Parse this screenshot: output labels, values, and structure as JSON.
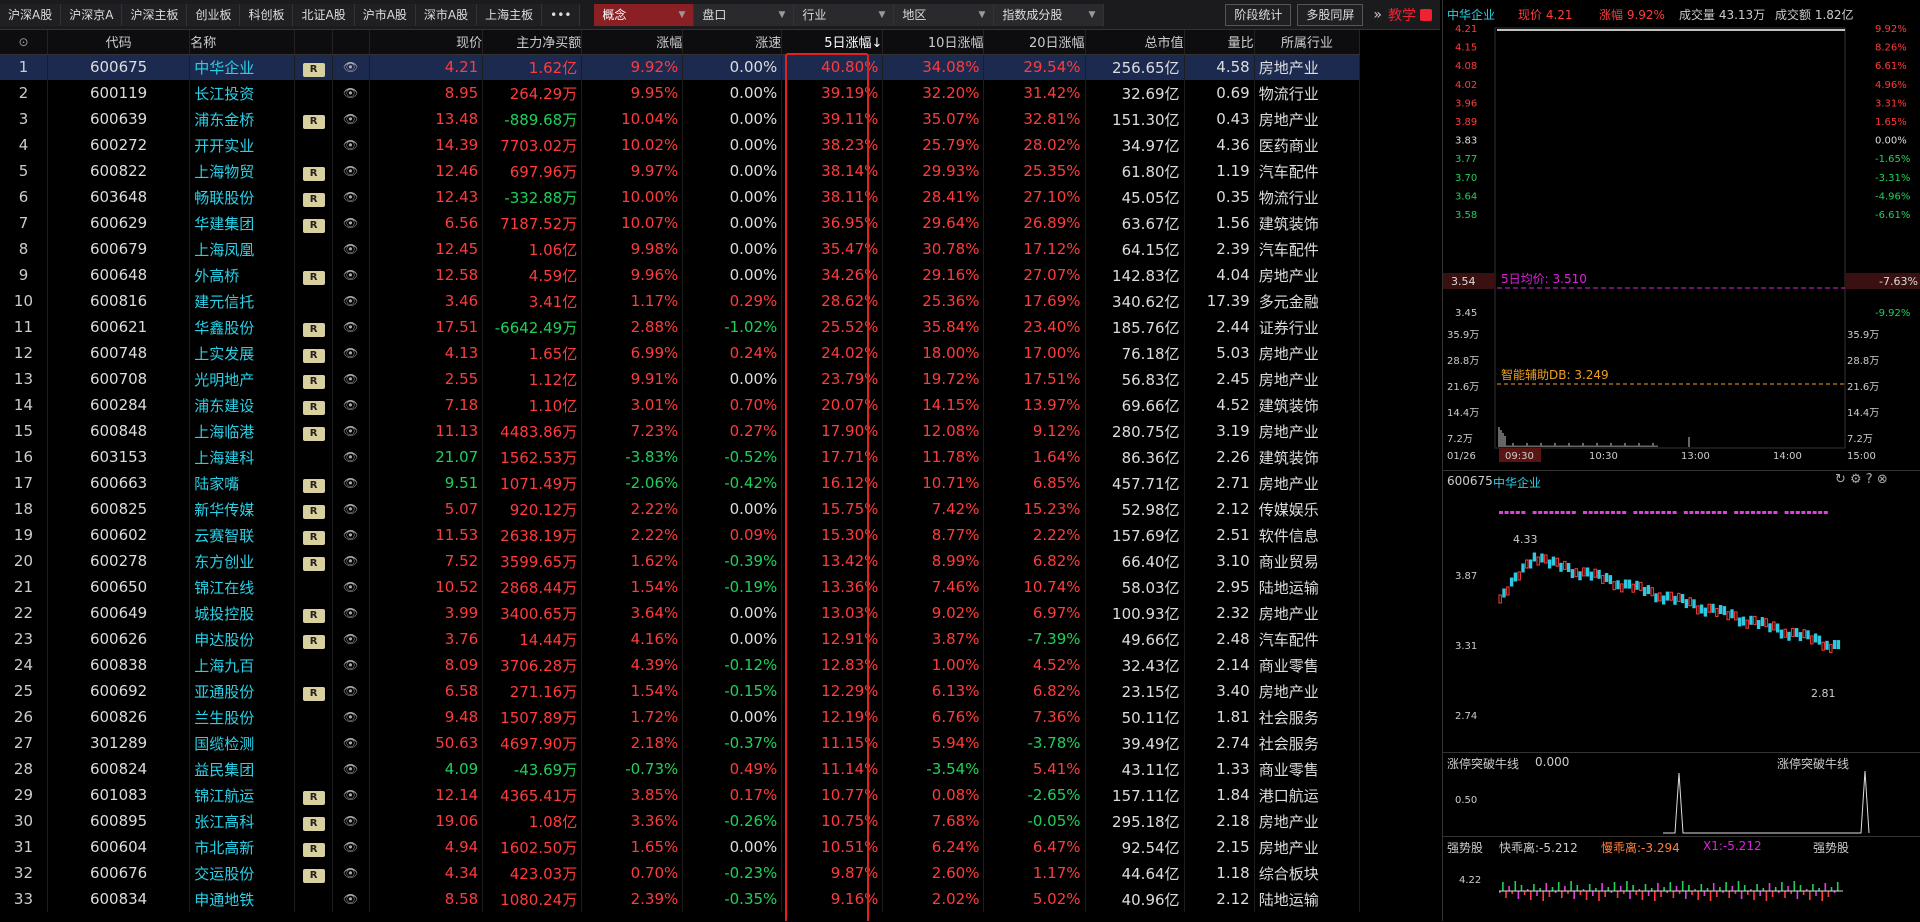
{
  "toolbar": {
    "tabs": [
      "沪深A股",
      "沪深京A",
      "沪深主板",
      "创业板",
      "科创板",
      "北证A股",
      "沪市A股",
      "深市A股",
      "上海主板"
    ],
    "more": "•••",
    "dropdowns": [
      "概念",
      "盘口",
      "行业",
      "地区",
      "指数成分股"
    ],
    "active_dropdown": "概念",
    "buttons": [
      "阶段统计",
      "多股同屏"
    ],
    "teach": "教学"
  },
  "table": {
    "headers": [
      "代码",
      "名称",
      "",
      "",
      "现价",
      "主力净买额",
      "涨幅",
      "涨速",
      "5日涨幅↓",
      "10日涨幅",
      "20日涨幅",
      "总市值",
      "量比",
      "所属行业"
    ],
    "rows": [
      {
        "i": "1",
        "code": "600675",
        "name": "中华企业",
        "r": true,
        "price": "4.21",
        "pc": "red",
        "net": "1.62亿",
        "nc": "red",
        "chg": "9.92%",
        "cc": "red",
        "spd": "0.00%",
        "sc": "white",
        "d5": "40.80%",
        "d5c": "red",
        "d10": "34.08%",
        "d10c": "red",
        "d20": "29.54%",
        "d20c": "red",
        "cap": "256.65亿",
        "vr": "4.58",
        "ind": "房地产业"
      },
      {
        "i": "2",
        "code": "600119",
        "name": "长江投资",
        "r": false,
        "price": "8.95",
        "pc": "red",
        "net": "264.29万",
        "nc": "red",
        "chg": "9.95%",
        "cc": "red",
        "spd": "0.00%",
        "sc": "white",
        "d5": "39.19%",
        "d5c": "red",
        "d10": "32.20%",
        "d10c": "red",
        "d20": "31.42%",
        "d20c": "red",
        "cap": "32.69亿",
        "vr": "0.69",
        "ind": "物流行业"
      },
      {
        "i": "3",
        "code": "600639",
        "name": "浦东金桥",
        "r": true,
        "price": "13.48",
        "pc": "red",
        "net": "-889.68万",
        "nc": "green",
        "chg": "10.04%",
        "cc": "red",
        "spd": "0.00%",
        "sc": "white",
        "d5": "39.11%",
        "d5c": "red",
        "d10": "35.07%",
        "d10c": "red",
        "d20": "32.81%",
        "d20c": "red",
        "cap": "151.30亿",
        "vr": "0.43",
        "ind": "房地产业"
      },
      {
        "i": "4",
        "code": "600272",
        "name": "开开实业",
        "r": false,
        "price": "14.39",
        "pc": "red",
        "net": "7703.02万",
        "nc": "red",
        "chg": "10.02%",
        "cc": "red",
        "spd": "0.00%",
        "sc": "white",
        "d5": "38.23%",
        "d5c": "red",
        "d10": "25.79%",
        "d10c": "red",
        "d20": "28.02%",
        "d20c": "red",
        "cap": "34.97亿",
        "vr": "4.36",
        "ind": "医药商业"
      },
      {
        "i": "5",
        "code": "600822",
        "name": "上海物贸",
        "r": true,
        "price": "12.46",
        "pc": "red",
        "net": "697.96万",
        "nc": "red",
        "chg": "9.97%",
        "cc": "red",
        "spd": "0.00%",
        "sc": "white",
        "d5": "38.14%",
        "d5c": "red",
        "d10": "29.93%",
        "d10c": "red",
        "d20": "25.35%",
        "d20c": "red",
        "cap": "61.80亿",
        "vr": "1.19",
        "ind": "汽车配件"
      },
      {
        "i": "6",
        "code": "603648",
        "name": "畅联股份",
        "r": true,
        "price": "12.43",
        "pc": "red",
        "net": "-332.88万",
        "nc": "green",
        "chg": "10.00%",
        "cc": "red",
        "spd": "0.00%",
        "sc": "white",
        "d5": "38.11%",
        "d5c": "red",
        "d10": "28.41%",
        "d10c": "red",
        "d20": "27.10%",
        "d20c": "red",
        "cap": "45.05亿",
        "vr": "0.35",
        "ind": "物流行业"
      },
      {
        "i": "7",
        "code": "600629",
        "name": "华建集团",
        "r": true,
        "price": "6.56",
        "pc": "red",
        "net": "7187.52万",
        "nc": "red",
        "chg": "10.07%",
        "cc": "red",
        "spd": "0.00%",
        "sc": "white",
        "d5": "36.95%",
        "d5c": "red",
        "d10": "29.64%",
        "d10c": "red",
        "d20": "26.89%",
        "d20c": "red",
        "cap": "63.67亿",
        "vr": "1.56",
        "ind": "建筑装饰"
      },
      {
        "i": "8",
        "code": "600679",
        "name": "上海凤凰",
        "r": false,
        "price": "12.45",
        "pc": "red",
        "net": "1.06亿",
        "nc": "red",
        "chg": "9.98%",
        "cc": "red",
        "spd": "0.00%",
        "sc": "white",
        "d5": "35.47%",
        "d5c": "red",
        "d10": "30.78%",
        "d10c": "red",
        "d20": "17.12%",
        "d20c": "red",
        "cap": "64.15亿",
        "vr": "2.39",
        "ind": "汽车配件"
      },
      {
        "i": "9",
        "code": "600648",
        "name": "外高桥",
        "r": true,
        "price": "12.58",
        "pc": "red",
        "net": "4.59亿",
        "nc": "red",
        "chg": "9.96%",
        "cc": "red",
        "spd": "0.00%",
        "sc": "white",
        "d5": "34.26%",
        "d5c": "red",
        "d10": "29.16%",
        "d10c": "red",
        "d20": "27.07%",
        "d20c": "red",
        "cap": "142.83亿",
        "vr": "4.04",
        "ind": "房地产业"
      },
      {
        "i": "10",
        "code": "600816",
        "name": "建元信托",
        "r": false,
        "price": "3.46",
        "pc": "red",
        "net": "3.41亿",
        "nc": "red",
        "chg": "1.17%",
        "cc": "red",
        "spd": "0.29%",
        "sc": "red",
        "d5": "28.62%",
        "d5c": "red",
        "d10": "25.36%",
        "d10c": "red",
        "d20": "17.69%",
        "d20c": "red",
        "cap": "340.62亿",
        "vr": "17.39",
        "ind": "多元金融"
      },
      {
        "i": "11",
        "code": "600621",
        "name": "华鑫股份",
        "r": true,
        "price": "17.51",
        "pc": "red",
        "net": "-6642.49万",
        "nc": "green",
        "chg": "2.88%",
        "cc": "red",
        "spd": "-1.02%",
        "sc": "green",
        "d5": "25.52%",
        "d5c": "red",
        "d10": "35.84%",
        "d10c": "red",
        "d20": "23.40%",
        "d20c": "red",
        "cap": "185.76亿",
        "vr": "2.44",
        "ind": "证券行业"
      },
      {
        "i": "12",
        "code": "600748",
        "name": "上实发展",
        "r": true,
        "price": "4.13",
        "pc": "red",
        "net": "1.65亿",
        "nc": "red",
        "chg": "6.99%",
        "cc": "red",
        "spd": "0.24%",
        "sc": "red",
        "d5": "24.02%",
        "d5c": "red",
        "d10": "18.00%",
        "d10c": "red",
        "d20": "17.00%",
        "d20c": "red",
        "cap": "76.18亿",
        "vr": "5.03",
        "ind": "房地产业"
      },
      {
        "i": "13",
        "code": "600708",
        "name": "光明地产",
        "r": true,
        "price": "2.55",
        "pc": "red",
        "net": "1.12亿",
        "nc": "red",
        "chg": "9.91%",
        "cc": "red",
        "spd": "0.00%",
        "sc": "white",
        "d5": "23.79%",
        "d5c": "red",
        "d10": "19.72%",
        "d10c": "red",
        "d20": "17.51%",
        "d20c": "red",
        "cap": "56.83亿",
        "vr": "2.45",
        "ind": "房地产业"
      },
      {
        "i": "14",
        "code": "600284",
        "name": "浦东建设",
        "r": true,
        "price": "7.18",
        "pc": "red",
        "net": "1.10亿",
        "nc": "red",
        "chg": "3.01%",
        "cc": "red",
        "spd": "0.70%",
        "sc": "red",
        "d5": "20.07%",
        "d5c": "red",
        "d10": "14.15%",
        "d10c": "red",
        "d20": "13.97%",
        "d20c": "red",
        "cap": "69.66亿",
        "vr": "4.52",
        "ind": "建筑装饰"
      },
      {
        "i": "15",
        "code": "600848",
        "name": "上海临港",
        "r": true,
        "price": "11.13",
        "pc": "red",
        "net": "4483.86万",
        "nc": "red",
        "chg": "7.23%",
        "cc": "red",
        "spd": "0.27%",
        "sc": "red",
        "d5": "17.90%",
        "d5c": "red",
        "d10": "12.08%",
        "d10c": "red",
        "d20": "9.12%",
        "d20c": "red",
        "cap": "280.75亿",
        "vr": "3.19",
        "ind": "房地产业"
      },
      {
        "i": "16",
        "code": "603153",
        "name": "上海建科",
        "r": false,
        "price": "21.07",
        "pc": "green",
        "net": "1562.53万",
        "nc": "red",
        "chg": "-3.83%",
        "cc": "green",
        "spd": "-0.52%",
        "sc": "green",
        "d5": "17.71%",
        "d5c": "red",
        "d10": "11.78%",
        "d10c": "red",
        "d20": "1.64%",
        "d20c": "red",
        "cap": "86.36亿",
        "vr": "2.26",
        "ind": "建筑装饰"
      },
      {
        "i": "17",
        "code": "600663",
        "name": "陆家嘴",
        "r": true,
        "price": "9.51",
        "pc": "green",
        "net": "1071.49万",
        "nc": "red",
        "chg": "-2.06%",
        "cc": "green",
        "spd": "-0.42%",
        "sc": "green",
        "d5": "16.12%",
        "d5c": "red",
        "d10": "10.71%",
        "d10c": "red",
        "d20": "6.85%",
        "d20c": "red",
        "cap": "457.71亿",
        "vr": "2.71",
        "ind": "房地产业"
      },
      {
        "i": "18",
        "code": "600825",
        "name": "新华传媒",
        "r": true,
        "price": "5.07",
        "pc": "red",
        "net": "920.12万",
        "nc": "red",
        "chg": "2.22%",
        "cc": "red",
        "spd": "0.00%",
        "sc": "white",
        "d5": "15.75%",
        "d5c": "red",
        "d10": "7.42%",
        "d10c": "red",
        "d20": "15.23%",
        "d20c": "red",
        "cap": "52.98亿",
        "vr": "2.12",
        "ind": "传媒娱乐"
      },
      {
        "i": "19",
        "code": "600602",
        "name": "云赛智联",
        "r": true,
        "price": "11.53",
        "pc": "red",
        "net": "2638.19万",
        "nc": "red",
        "chg": "2.22%",
        "cc": "red",
        "spd": "0.09%",
        "sc": "red",
        "d5": "15.30%",
        "d5c": "red",
        "d10": "8.77%",
        "d10c": "red",
        "d20": "2.22%",
        "d20c": "red",
        "cap": "157.69亿",
        "vr": "2.51",
        "ind": "软件信息"
      },
      {
        "i": "20",
        "code": "600278",
        "name": "东方创业",
        "r": true,
        "price": "7.52",
        "pc": "red",
        "net": "3599.65万",
        "nc": "red",
        "chg": "1.62%",
        "cc": "red",
        "spd": "-0.39%",
        "sc": "green",
        "d5": "13.42%",
        "d5c": "red",
        "d10": "8.99%",
        "d10c": "red",
        "d20": "6.82%",
        "d20c": "red",
        "cap": "66.40亿",
        "vr": "3.10",
        "ind": "商业贸易"
      },
      {
        "i": "21",
        "code": "600650",
        "name": "锦江在线",
        "r": false,
        "price": "10.52",
        "pc": "red",
        "net": "2868.44万",
        "nc": "red",
        "chg": "1.54%",
        "cc": "red",
        "spd": "-0.19%",
        "sc": "green",
        "d5": "13.36%",
        "d5c": "red",
        "d10": "7.46%",
        "d10c": "red",
        "d20": "10.74%",
        "d20c": "red",
        "cap": "58.03亿",
        "vr": "2.95",
        "ind": "陆地运输"
      },
      {
        "i": "22",
        "code": "600649",
        "name": "城投控股",
        "r": true,
        "price": "3.99",
        "pc": "red",
        "net": "3400.65万",
        "nc": "red",
        "chg": "3.64%",
        "cc": "red",
        "spd": "0.00%",
        "sc": "white",
        "d5": "13.03%",
        "d5c": "red",
        "d10": "9.02%",
        "d10c": "red",
        "d20": "6.97%",
        "d20c": "red",
        "cap": "100.93亿",
        "vr": "2.32",
        "ind": "房地产业"
      },
      {
        "i": "23",
        "code": "600626",
        "name": "申达股份",
        "r": true,
        "price": "3.76",
        "pc": "red",
        "net": "14.44万",
        "nc": "red",
        "chg": "4.16%",
        "cc": "red",
        "spd": "0.00%",
        "sc": "white",
        "d5": "12.91%",
        "d5c": "red",
        "d10": "3.87%",
        "d10c": "red",
        "d20": "-7.39%",
        "d20c": "green",
        "cap": "49.66亿",
        "vr": "2.48",
        "ind": "汽车配件"
      },
      {
        "i": "24",
        "code": "600838",
        "name": "上海九百",
        "r": false,
        "price": "8.09",
        "pc": "red",
        "net": "3706.28万",
        "nc": "red",
        "chg": "4.39%",
        "cc": "red",
        "spd": "-0.12%",
        "sc": "green",
        "d5": "12.83%",
        "d5c": "red",
        "d10": "1.00%",
        "d10c": "red",
        "d20": "4.52%",
        "d20c": "red",
        "cap": "32.43亿",
        "vr": "2.14",
        "ind": "商业零售"
      },
      {
        "i": "25",
        "code": "600692",
        "name": "亚通股份",
        "r": true,
        "price": "6.58",
        "pc": "red",
        "net": "271.16万",
        "nc": "red",
        "chg": "1.54%",
        "cc": "red",
        "spd": "-0.15%",
        "sc": "green",
        "d5": "12.29%",
        "d5c": "red",
        "d10": "6.13%",
        "d10c": "red",
        "d20": "6.82%",
        "d20c": "red",
        "cap": "23.15亿",
        "vr": "3.40",
        "ind": "房地产业"
      },
      {
        "i": "26",
        "code": "600826",
        "name": "兰生股份",
        "r": false,
        "price": "9.48",
        "pc": "red",
        "net": "1507.89万",
        "nc": "red",
        "chg": "1.72%",
        "cc": "red",
        "spd": "0.00%",
        "sc": "white",
        "d5": "12.19%",
        "d5c": "red",
        "d10": "6.76%",
        "d10c": "red",
        "d20": "7.36%",
        "d20c": "red",
        "cap": "50.11亿",
        "vr": "1.81",
        "ind": "社会服务"
      },
      {
        "i": "27",
        "code": "301289",
        "name": "国缆检测",
        "r": false,
        "price": "50.63",
        "pc": "red",
        "net": "4697.90万",
        "nc": "red",
        "chg": "2.18%",
        "cc": "red",
        "spd": "-0.37%",
        "sc": "green",
        "d5": "11.15%",
        "d5c": "red",
        "d10": "5.94%",
        "d10c": "red",
        "d20": "-3.78%",
        "d20c": "green",
        "cap": "39.49亿",
        "vr": "2.74",
        "ind": "社会服务"
      },
      {
        "i": "28",
        "code": "600824",
        "name": "益民集团",
        "r": false,
        "price": "4.09",
        "pc": "green",
        "net": "-43.69万",
        "nc": "green",
        "chg": "-0.73%",
        "cc": "green",
        "spd": "0.49%",
        "sc": "red",
        "d5": "11.14%",
        "d5c": "red",
        "d10": "-3.54%",
        "d10c": "green",
        "d20": "5.41%",
        "d20c": "red",
        "cap": "43.11亿",
        "vr": "1.33",
        "ind": "商业零售"
      },
      {
        "i": "29",
        "code": "601083",
        "name": "锦江航运",
        "r": true,
        "price": "12.14",
        "pc": "red",
        "net": "4365.41万",
        "nc": "red",
        "chg": "3.85%",
        "cc": "red",
        "spd": "0.17%",
        "sc": "red",
        "d5": "10.77%",
        "d5c": "red",
        "d10": "0.08%",
        "d10c": "red",
        "d20": "-2.65%",
        "d20c": "green",
        "cap": "157.11亿",
        "vr": "1.84",
        "ind": "港口航运"
      },
      {
        "i": "30",
        "code": "600895",
        "name": "张江高科",
        "r": true,
        "price": "19.06",
        "pc": "red",
        "net": "1.08亿",
        "nc": "red",
        "chg": "3.36%",
        "cc": "red",
        "spd": "-0.26%",
        "sc": "green",
        "d5": "10.75%",
        "d5c": "red",
        "d10": "7.68%",
        "d10c": "red",
        "d20": "-0.05%",
        "d20c": "green",
        "cap": "295.18亿",
        "vr": "2.18",
        "ind": "房地产业"
      },
      {
        "i": "31",
        "code": "600604",
        "name": "市北高新",
        "r": true,
        "price": "4.94",
        "pc": "red",
        "net": "1602.50万",
        "nc": "red",
        "chg": "1.65%",
        "cc": "red",
        "spd": "0.00%",
        "sc": "white",
        "d5": "10.51%",
        "d5c": "red",
        "d10": "6.24%",
        "d10c": "red",
        "d20": "6.47%",
        "d20c": "red",
        "cap": "92.54亿",
        "vr": "2.15",
        "ind": "房地产业"
      },
      {
        "i": "32",
        "code": "600676",
        "name": "交运股份",
        "r": true,
        "price": "4.34",
        "pc": "red",
        "net": "423.03万",
        "nc": "red",
        "chg": "0.70%",
        "cc": "red",
        "spd": "-0.23%",
        "sc": "green",
        "d5": "9.87%",
        "d5c": "red",
        "d10": "2.60%",
        "d10c": "red",
        "d20": "1.17%",
        "d20c": "red",
        "cap": "44.64亿",
        "vr": "1.18",
        "ind": "综合板块"
      },
      {
        "i": "33",
        "code": "600834",
        "name": "申通地铁",
        "r": false,
        "price": "8.58",
        "pc": "red",
        "net": "1080.24万",
        "nc": "red",
        "chg": "2.39%",
        "cc": "red",
        "spd": "-0.35%",
        "sc": "green",
        "d5": "9.16%",
        "d5c": "red",
        "d10": "2.02%",
        "d10c": "red",
        "d20": "5.02%",
        "d20c": "red",
        "cap": "40.96亿",
        "vr": "2.12",
        "ind": "陆地运输"
      }
    ]
  },
  "right": {
    "stock_name": "中华企业",
    "price_label": "现价 4.21",
    "change_label": "涨幅 9.92%",
    "volume_label": "成交量 43.13万",
    "amount_label": "成交额 1.82亿",
    "price_ticks": [
      "4.21",
      "4.15",
      "4.08",
      "4.02",
      "3.96",
      "3.89",
      "3.83",
      "3.77",
      "3.70",
      "3.64",
      "3.58"
    ],
    "pct_ticks": [
      "9.92%",
      "8.26%",
      "6.61%",
      "4.96%",
      "3.31%",
      "1.65%",
      "0.00%",
      "-1.65%",
      "-3.31%",
      "-4.96%",
      "-6.61%"
    ],
    "avg_label": "5日均价: 3.510",
    "low_price": "3.54",
    "low_pct": "-7.63%",
    "price_tick_345": "3.45",
    "pct_tick_992n": "-9.92%",
    "vol_ticks": [
      "35.9万",
      "28.8万",
      "21.6万",
      "14.4万",
      "7.2万"
    ],
    "vol_ticks_r": [
      "35.9万",
      "28.8万",
      "21.6万",
      "14.4万",
      "7.2万"
    ],
    "db_label": "智能辅助DB: 3.249",
    "time_ticks": [
      "01/26",
      "09:30",
      "10:30",
      "13:00",
      "14:00",
      "15:00"
    ],
    "k_code": "600675",
    "k_name": "中华企业",
    "k_ticks": [
      "3.87",
      "3.31",
      "2.74"
    ],
    "k_high": "4.33",
    "k_low": "2.81",
    "ind1_name": "涨停突破牛线",
    "ind1_value": "0.000",
    "ind1_right": "涨停突破牛线",
    "ind1_tick": "0.50",
    "ind2_name": "强势股",
    "ind2_fast": "快乖离:-5.212",
    "ind2_slow": "慢乖离:-3.294",
    "ind2_x1": "X1:-5.212",
    "ind2_right": "强势股",
    "ind2_tick": "4.22"
  }
}
